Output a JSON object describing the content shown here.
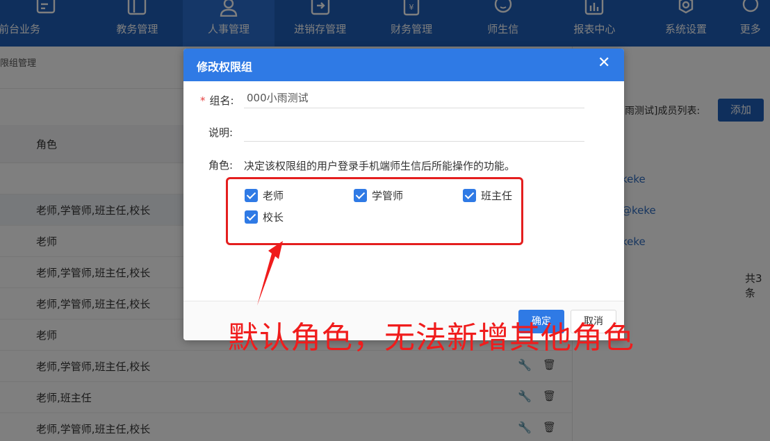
{
  "nav": {
    "items": [
      {
        "label": "前台业务",
        "icon": "desk-icon"
      },
      {
        "label": "教务管理",
        "icon": "book-icon"
      },
      {
        "label": "人事管理",
        "icon": "person-icon",
        "active": true
      },
      {
        "label": "进销存管理",
        "icon": "inventory-icon"
      },
      {
        "label": "财务管理",
        "icon": "finance-icon"
      },
      {
        "label": "师生信",
        "icon": "message-icon"
      },
      {
        "label": "报表中心",
        "icon": "report-icon"
      },
      {
        "label": "系统设置",
        "icon": "gear-icon"
      },
      {
        "label": "更多",
        "icon": "more-icon"
      }
    ]
  },
  "breadcrumb": "限组管理",
  "table": {
    "header": "角色",
    "rows": [
      "",
      "老师,学管师,班主任,校长",
      "老师",
      "老师,学管师,班主任,校长",
      "老师,学管师,班主任,校长",
      "老师",
      "老师,学管师,班主任,校长",
      "老师,班主任",
      "老师,学管师,班主任,校长"
    ]
  },
  "right_panel": {
    "title": "雨测试]成员列表:",
    "add_label": "添加",
    "links": [
      "keke",
      "@keke",
      "keke"
    ],
    "total": "共3条"
  },
  "modal": {
    "title": "修改权限组",
    "close": "✕",
    "required_mark": "*",
    "name_label": "组名:",
    "name_value": "000小雨测试",
    "desc_label": "说明:",
    "desc_value": "",
    "role_label": "角色:",
    "role_hint": "决定该权限组的用户登录手机端师生信后所能操作的功能。",
    "roles": [
      {
        "label": "老师",
        "checked": true
      },
      {
        "label": "学管师",
        "checked": true
      },
      {
        "label": "班主任",
        "checked": true
      },
      {
        "label": "校长",
        "checked": true
      }
    ],
    "ok_label": "确定",
    "cancel_label": "取消"
  },
  "annotation": {
    "text": "默认角色，无法新增其他角色",
    "color": "#f01c1c"
  }
}
